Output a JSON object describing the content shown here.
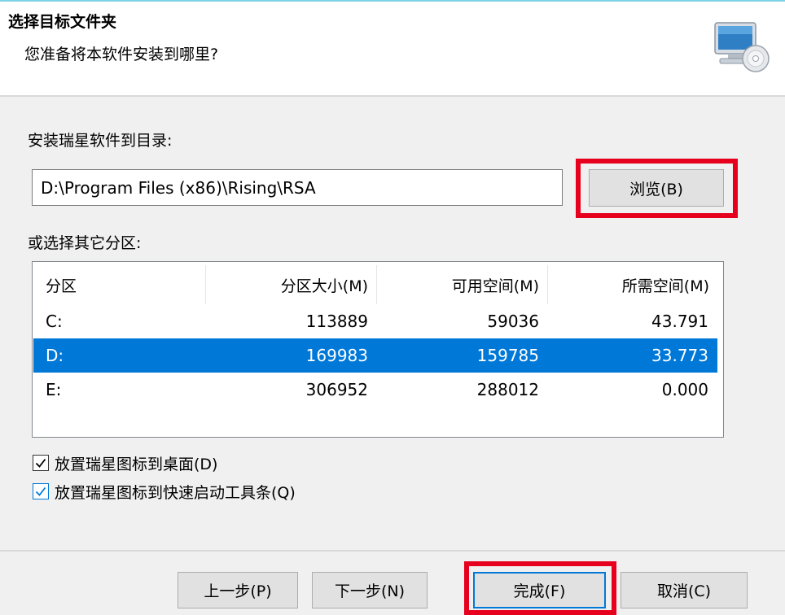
{
  "header": {
    "title": "选择目标文件夹",
    "subtitle": "您准备将本软件安装到哪里?",
    "icon": "computer-cd-icon"
  },
  "install_dir": {
    "label": "安装瑞星软件到目录:",
    "path_value": "D:\\Program Files (x86)\\Rising\\RSA",
    "browse_label": "浏览(B)"
  },
  "partition": {
    "label": "或选择其它分区:",
    "columns": [
      "分区",
      "分区大小(M)",
      "可用空间(M)",
      "所需空间(M)"
    ],
    "rows": [
      {
        "name": "C:",
        "size": "113889",
        "free": "59036",
        "required": "43.791",
        "selected": false
      },
      {
        "name": "D:",
        "size": "169983",
        "free": "159785",
        "required": "33.773",
        "selected": true
      },
      {
        "name": "E:",
        "size": "306952",
        "free": "288012",
        "required": "0.000",
        "selected": false
      }
    ]
  },
  "options": {
    "desktop_icon": {
      "label": "放置瑞星图标到桌面(D)",
      "checked": true
    },
    "quicklaunch_icon": {
      "label": "放置瑞星图标到快速启动工具条(Q)",
      "checked": true
    }
  },
  "footer": {
    "prev_label": "上一步(P)",
    "next_label": "下一步(N)",
    "finish_label": "完成(F)",
    "cancel_label": "取消(C)"
  },
  "colors": {
    "selection": "#0078d7",
    "highlight_box": "#e6001e"
  }
}
